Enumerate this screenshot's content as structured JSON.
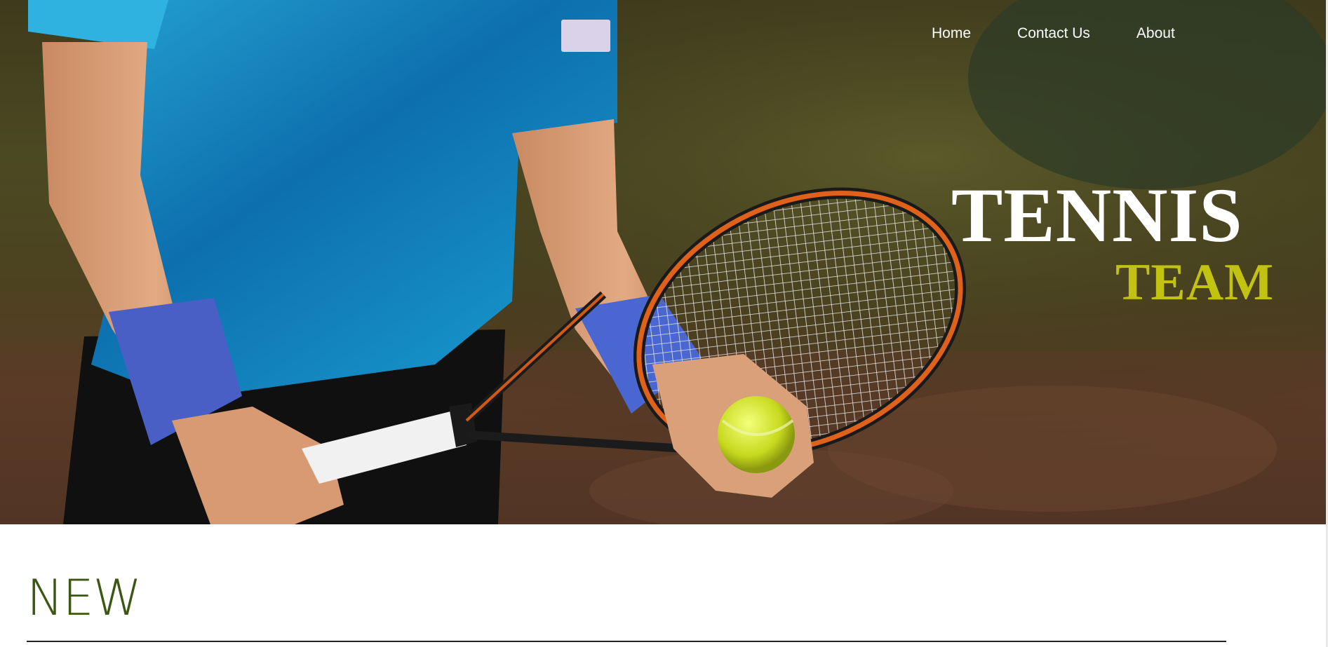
{
  "nav": {
    "items": [
      {
        "label": "Home"
      },
      {
        "label": "Contact Us"
      },
      {
        "label": "About"
      }
    ]
  },
  "hero": {
    "title": "TENNIS",
    "subtitle": "TEAM",
    "title_color": "#ffffff",
    "subtitle_color": "#c2c211",
    "image": "tennis-player-serving"
  },
  "section": {
    "title": "NEW",
    "title_color": "#3b5714"
  }
}
